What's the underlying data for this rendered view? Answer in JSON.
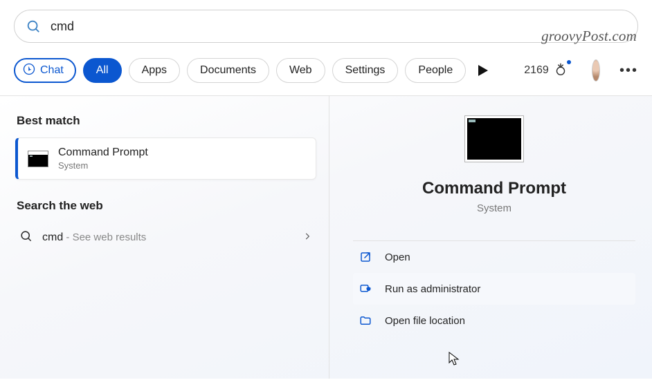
{
  "watermark": "groovyPost.com",
  "search": {
    "value": "cmd"
  },
  "filters": {
    "chat": "Chat",
    "all": "All",
    "apps": "Apps",
    "documents": "Documents",
    "web": "Web",
    "settings": "Settings",
    "people": "People"
  },
  "rewards": {
    "points": "2169"
  },
  "left": {
    "best_match_heading": "Best match",
    "result": {
      "name": "Command Prompt",
      "subtitle": "System"
    },
    "search_web_heading": "Search the web",
    "web_item": {
      "term": "cmd",
      "hint": " - See web results"
    }
  },
  "preview": {
    "title": "Command Prompt",
    "subtitle": "System",
    "actions": {
      "open": "Open",
      "run_admin": "Run as administrator",
      "open_location": "Open file location"
    }
  }
}
